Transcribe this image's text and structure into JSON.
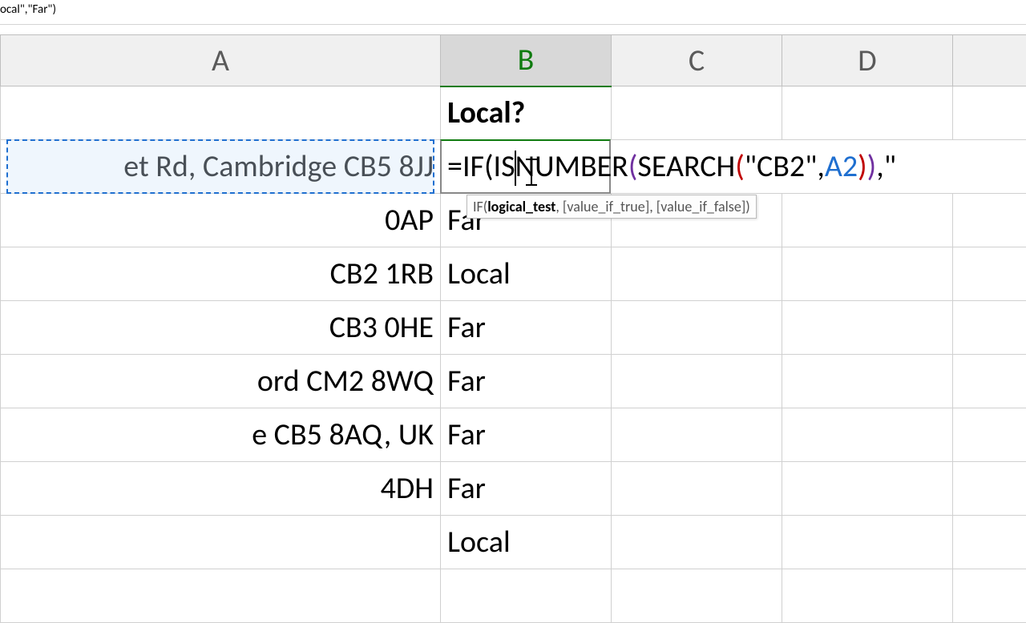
{
  "formula_bar_fragment": "ocal\",\"Far\")",
  "columns": {
    "A": "A",
    "B": "B",
    "C": "C",
    "D": "D"
  },
  "header_row": {
    "B": "Local?"
  },
  "formula_edit": {
    "eq": "=",
    "if_name": "IF",
    "open1": "(",
    "isnumber_name": "ISNUMBER",
    "open2": "(",
    "search_name": "SEARCH",
    "open3": "(",
    "str_cb2": "\"CB2\"",
    "comma1": ",",
    "a2ref": "A2",
    "close3": ")",
    "close2": ")",
    "comma2": ",",
    "trailing_quote": "\"",
    "caret_after": "IS"
  },
  "tooltip": {
    "fn": "IF(",
    "bold_arg": "logical_test",
    "rest": ", [value_if_true], [value_if_false])"
  },
  "rows": [
    {
      "A": "et Rd, Cambridge CB5 8JJ",
      "B_is_formula": true
    },
    {
      "A": "0AP",
      "B": "Far"
    },
    {
      "A": "CB2 1RB",
      "B": "Local"
    },
    {
      "A": " CB3 0HE",
      "B": "Far"
    },
    {
      "A": "ord CM2 8WQ",
      "B": "Far"
    },
    {
      "A": "e CB5 8AQ, UK",
      "B": "Far"
    },
    {
      "A": "4DH",
      "B": "Far"
    },
    {
      "A": "",
      "B": "Local"
    }
  ]
}
